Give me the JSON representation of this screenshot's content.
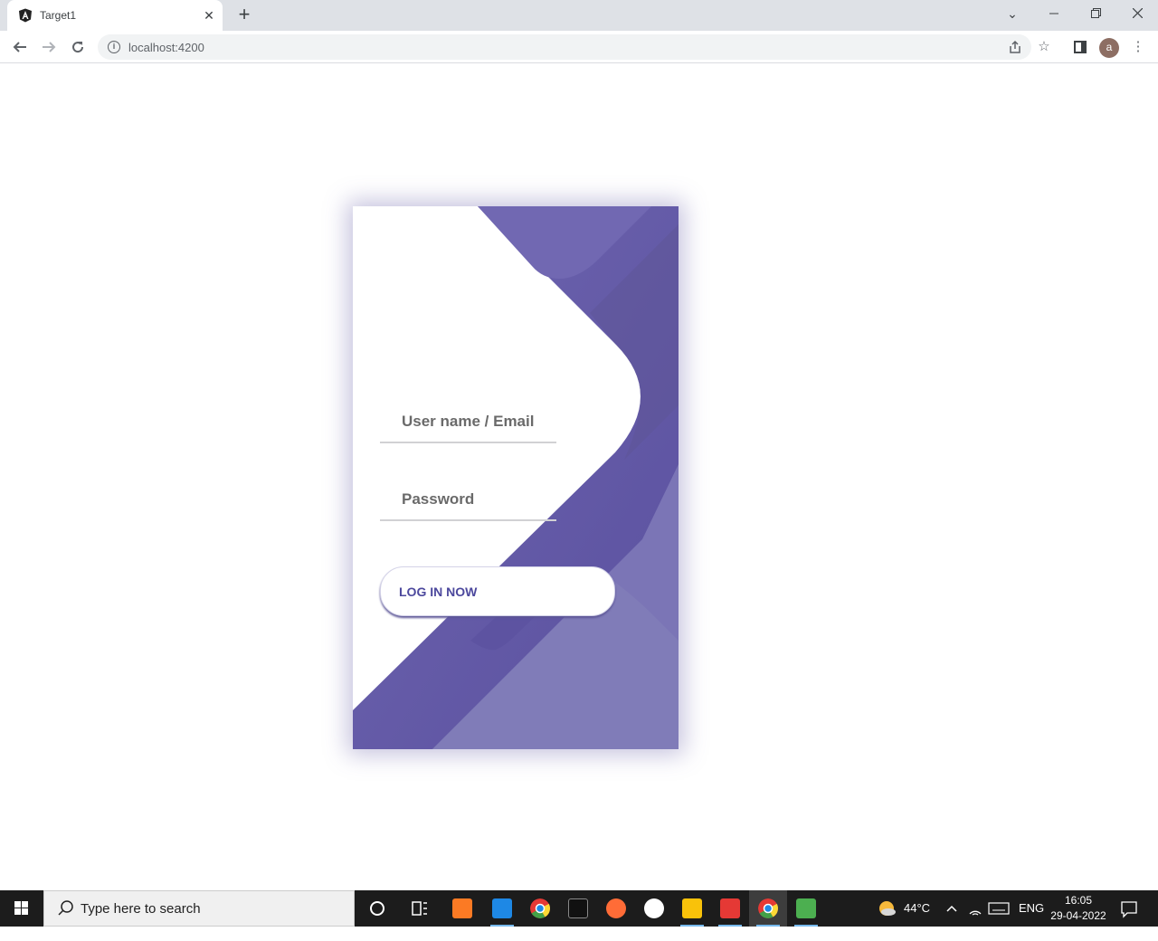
{
  "browser": {
    "tab_title": "Target1",
    "tab_close": "✕",
    "new_tab": "+",
    "url": "localhost:4200",
    "profile_initial": "a"
  },
  "login": {
    "username_placeholder": "User name / Email",
    "password_placeholder": "Password",
    "submit_label": "LOG IN NOW",
    "colors": {
      "primary": "#5d54a4",
      "accent": "#7c78b8",
      "button_text": "#4c489d"
    }
  },
  "taskbar": {
    "search_placeholder": "Type here to search",
    "temperature": "44°C",
    "language": "ENG",
    "time": "16:05",
    "date": "29-04-2022"
  }
}
